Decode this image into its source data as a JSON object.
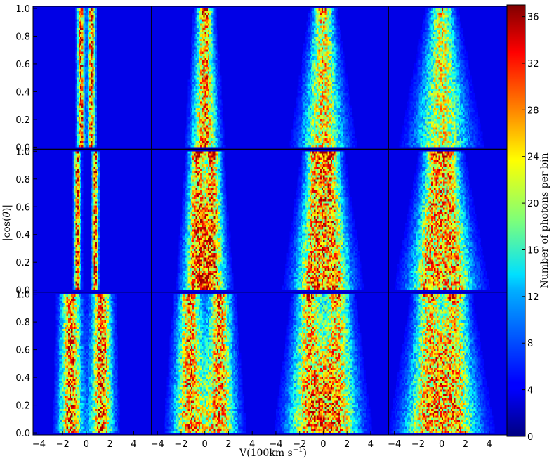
{
  "chart_data": {
    "type": "heatmap",
    "layout": {
      "rows": 3,
      "cols": 4
    },
    "xlabel": "V(100km s",
    "xlabel_exponent": "−1",
    "xlabel_close": ")",
    "ylabel_prefix": "|cos(",
    "ylabel_theta": "θ",
    "ylabel_suffix": ")|",
    "colorbar_label": "Number of photons per bin",
    "xlim": [
      -4.5,
      5.5
    ],
    "ylim": [
      0.0,
      1.0
    ],
    "x_ticks": [
      -4,
      -2,
      0,
      2,
      4
    ],
    "x_tick_labels": [
      "−4",
      "−2",
      "0",
      "2",
      "4"
    ],
    "last_col_x_ticks": [
      -4,
      -2,
      0,
      2,
      4
    ],
    "last_col_x_tick_labels": [
      "−4",
      "−2",
      "0",
      "2",
      "4"
    ],
    "y_ticks": [
      0.0,
      0.2,
      0.4,
      0.6,
      0.8,
      1.0
    ],
    "y_tick_labels": [
      "0.0",
      "0.2",
      "0.4",
      "0.6",
      "0.8",
      "1.0"
    ],
    "colorbar_range": [
      0,
      37
    ],
    "colorbar_ticks": [
      0,
      4,
      8,
      12,
      16,
      20,
      24,
      28,
      32,
      36
    ],
    "colorbar_tick_labels": [
      "0",
      "4",
      "8",
      "12",
      "16",
      "20",
      "24",
      "28",
      "32",
      "36"
    ],
    "colormap": "jet",
    "panels": [
      {
        "row": 0,
        "col": 0,
        "peak_sep": 0.9,
        "width": 0.28,
        "spread": 0.0,
        "top_peak": 1.0
      },
      {
        "row": 0,
        "col": 1,
        "peak_sep": 0.0,
        "width": 0.55,
        "spread": 0.45,
        "top_peak": 1.4
      },
      {
        "row": 0,
        "col": 2,
        "peak_sep": 0.0,
        "width": 0.7,
        "spread": 0.95,
        "top_peak": 1.3
      },
      {
        "row": 0,
        "col": 3,
        "peak_sep": 0.0,
        "width": 0.8,
        "spread": 1.3,
        "top_peak": 1.2
      },
      {
        "row": 1,
        "col": 0,
        "peak_sep": 1.5,
        "width": 0.25,
        "spread": 0.0,
        "top_peak": 1.0
      },
      {
        "row": 1,
        "col": 1,
        "peak_sep": 1.3,
        "width": 0.55,
        "spread": 0.5,
        "top_peak": 1.6
      },
      {
        "row": 1,
        "col": 2,
        "peak_sep": 1.2,
        "width": 0.7,
        "spread": 0.95,
        "top_peak": 1.5
      },
      {
        "row": 1,
        "col": 3,
        "peak_sep": 1.1,
        "width": 0.8,
        "spread": 1.2,
        "top_peak": 1.4
      },
      {
        "row": 2,
        "col": 0,
        "peak_sep": 2.6,
        "width": 0.7,
        "spread": 0.2,
        "top_peak": 1.0
      },
      {
        "row": 2,
        "col": 1,
        "peak_sep": 2.5,
        "width": 0.8,
        "spread": 0.5,
        "top_peak": 1.1
      },
      {
        "row": 2,
        "col": 2,
        "peak_sep": 2.3,
        "width": 0.9,
        "spread": 0.85,
        "top_peak": 1.3
      },
      {
        "row": 2,
        "col": 3,
        "peak_sep": 2.1,
        "width": 0.9,
        "spread": 1.1,
        "top_peak": 1.4
      }
    ]
  }
}
